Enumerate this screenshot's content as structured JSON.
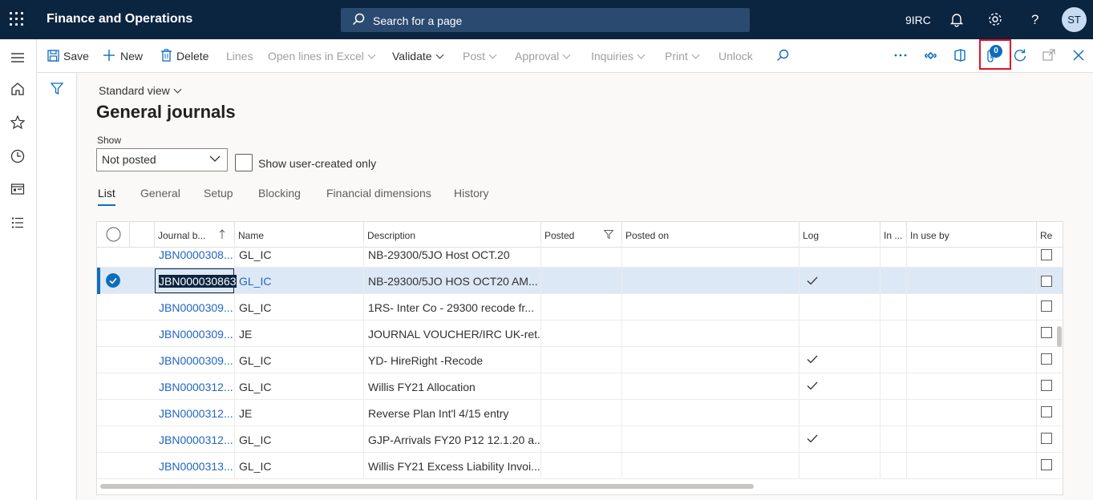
{
  "topbar": {
    "app_title": "Finance and Operations",
    "search_placeholder": "Search for a page",
    "company": "9IRC",
    "avatar_initials": "ST",
    "bg_color": "#0b2440"
  },
  "actionbar": {
    "save": "Save",
    "new": "New",
    "delete": "Delete",
    "lines": "Lines",
    "open_lines_excel": "Open lines in Excel",
    "validate": "Validate",
    "post": "Post",
    "approval": "Approval",
    "inquiries": "Inquiries",
    "print": "Print",
    "unlock": "Unlock",
    "attachments_count": "0",
    "icons": [
      "search-icon",
      "more-icon",
      "diamond-icon",
      "office-icon",
      "attachment-icon",
      "refresh-icon",
      "open-new-window-icon",
      "close-icon"
    ]
  },
  "leftnav": {
    "icons": [
      "hamburger-icon",
      "home-icon",
      "favorites-icon",
      "recent-icon",
      "workspaces-icon",
      "modules-icon"
    ]
  },
  "page": {
    "view_name": "Standard view",
    "title": "General journals",
    "show_label": "Show",
    "show_value": "Not posted",
    "user_created_label": "Show user-created only",
    "tabs": [
      "List",
      "General",
      "Setup",
      "Blocking",
      "Financial dimensions",
      "History"
    ]
  },
  "grid": {
    "columns": [
      "Journal b...",
      "Name",
      "Description",
      "Posted",
      "Posted on",
      "Log",
      "In ...",
      "In use by",
      "Re"
    ],
    "rows": [
      {
        "journal": "JBN0000308...",
        "name": "GL_IC",
        "description": "NB-29300/5JO Host OCT.20",
        "log": false
      },
      {
        "journal": "JBN000030863",
        "name": "GL_IC",
        "description": "NB-29300/5JO HOS OCT20 AM...",
        "log": true,
        "selected": true
      },
      {
        "journal": "JBN0000309...",
        "name": "GL_IC",
        "description": "1RS- Inter Co - 29300 recode fr...",
        "log": false
      },
      {
        "journal": "JBN0000309...",
        "name": "JE",
        "description": "JOURNAL VOUCHER/IRC UK-ret...",
        "log": false
      },
      {
        "journal": "JBN0000309...",
        "name": "GL_IC",
        "description": "YD- HireRight -Recode",
        "log": true
      },
      {
        "journal": "JBN0000312...",
        "name": "GL_IC",
        "description": "Willis FY21 Allocation",
        "log": true
      },
      {
        "journal": "JBN0000312...",
        "name": "JE",
        "description": "Reverse Plan Int'l 4/15 entry",
        "log": false
      },
      {
        "journal": "JBN0000312...",
        "name": "GL_IC",
        "description": "GJP-Arrivals FY20 P12 12.1.20 a...",
        "log": true
      },
      {
        "journal": "JBN0000313...",
        "name": "GL_IC",
        "description": "Willis FY21 Excess Liability Invoi...",
        "log": false
      }
    ],
    "link_color": "#2266c2",
    "selected_color": "#dce8f6"
  }
}
